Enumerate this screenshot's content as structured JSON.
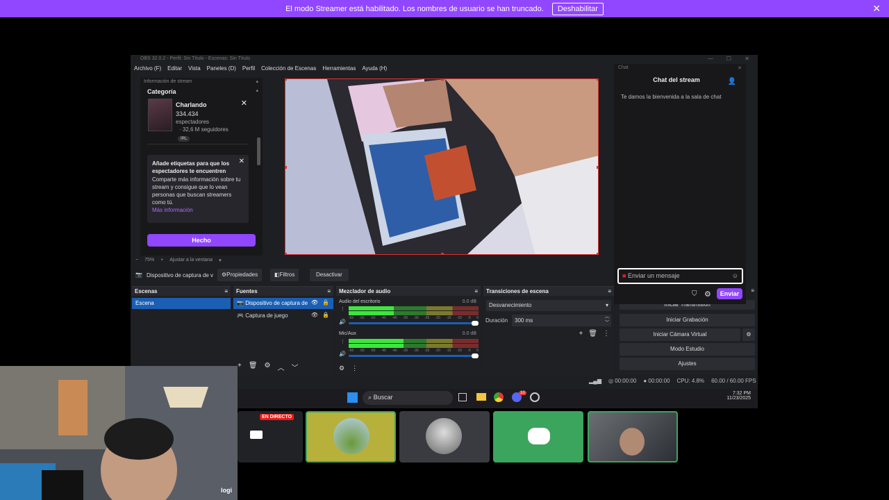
{
  "banner": {
    "message": "El modo Streamer está habilitado. Los nombres de usuario se han truncado.",
    "button": "Deshabilitar"
  },
  "obs": {
    "title": "OBS 32.0.2 - Perfil: Sin Título - Escenas: Sin Título",
    "menu": [
      "Archivo (F)",
      "Editar",
      "Vista",
      "Paneles (D)",
      "Perfil",
      "Colección de Escenas",
      "Herramientas",
      "Ayuda (H)"
    ],
    "stream_info": {
      "header": "Información de stream",
      "category_label": "Categoría",
      "category": "Charlando",
      "viewers": "334.434",
      "viewers_label": "espectadores",
      "followers": "32,6 M seguidores",
      "tag": "IRL",
      "tip_title": "Añade etiquetas para que los espectadores te encuentren",
      "tip_body": "Comparte más información sobre tu stream y consigue que lo vean personas que buscan streamers como tú.",
      "tip_link": "Más información",
      "done_button": "Hecho"
    },
    "zoom": {
      "minus": "−",
      "level": "75%",
      "plus": "+",
      "fit": "Ajustar a la ventana"
    },
    "source_toolbar": {
      "device": "Dispositivo de captura de v",
      "properties": "Propiedades",
      "filters": "Filtros",
      "deactivate": "Desactivar"
    },
    "docks": {
      "scenes": {
        "title": "Escenas",
        "items": [
          "Escena"
        ]
      },
      "sources": {
        "title": "Fuentes",
        "items": [
          "Dispositivo de captura de",
          "Captura de juego"
        ]
      },
      "mixer": {
        "title": "Mezclador de audio",
        "channels": [
          {
            "name": "Audio del escritorio",
            "db": "0.0 dB"
          },
          {
            "name": "Mic/Aux",
            "db": "0.0 dB"
          }
        ],
        "scale": [
          "-60",
          "-55",
          "-50",
          "-45",
          "-40",
          "-35",
          "-30",
          "-25",
          "-20",
          "-15",
          "-10",
          "-5",
          "0"
        ]
      },
      "transitions": {
        "title": "Transiciones de escena",
        "selected": "Desvanecimiento",
        "duration_label": "Duración",
        "duration": "300 ms"
      },
      "controls": {
        "start_stream": "Iniciar Transmisión",
        "start_recording": "Iniciar Grabación",
        "virtual_cam": "Iniciar Cámara Virtual",
        "studio_mode": "Modo Estudio",
        "settings": "Ajustes"
      }
    },
    "status": {
      "stream_time": "00:00:00",
      "rec_time": "00:00:00",
      "cpu": "CPU: 4.8%",
      "fps": "60.00 / 60.00 FPS"
    }
  },
  "chat": {
    "window_label": "Chat",
    "title": "Chat del stream",
    "welcome": "Te damos la bienvenida a la sala de chat",
    "placeholder": "Enviar un mensaje",
    "send": "Enviar"
  },
  "taskbar": {
    "search": "Buscar",
    "time": "7:32 PM",
    "date": "11/23/2025",
    "badge": "10"
  },
  "tiles": {
    "live_badge": "EN DIRECTO"
  },
  "webcam": {
    "brand": "logi"
  },
  "colors": {
    "twitch_purple": "#9147ff",
    "obs_bg": "#1e1f23",
    "selection": "#1a5fb4",
    "discord_green": "#3ba55d"
  }
}
